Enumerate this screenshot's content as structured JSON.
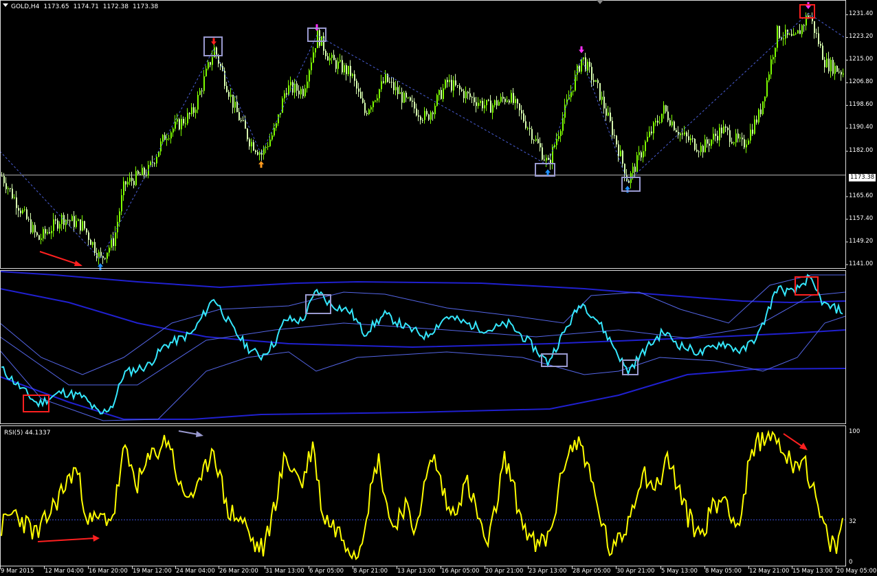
{
  "window": {
    "symbol": "GOLD,H4",
    "open": "1173.65",
    "high": "1174.71",
    "low": "1172.38",
    "close": "1173.38",
    "current_price": "1173.38"
  },
  "price_panel": {
    "y_labels": [
      "1231.40",
      "1223.20",
      "1215.00",
      "1206.80",
      "1198.60",
      "1190.40",
      "1182.00",
      "1173.38",
      "1165.60",
      "1157.40",
      "1149.20",
      "1141.00"
    ],
    "y_values": [
      1231.4,
      1223.2,
      1215.0,
      1206.8,
      1198.6,
      1190.4,
      1182.0,
      1173.38,
      1165.6,
      1157.4,
      1149.2,
      1141.0
    ],
    "ylim": [
      1138.5,
      1235.5
    ],
    "arrow_colors": {
      "up_blue": "#1e90ff",
      "up_orange": "#ff9a1e",
      "down_red": "#ff2020",
      "down_magenta": "#ff30ff"
    }
  },
  "indicator_panel": {
    "label": ""
  },
  "rsi_panel": {
    "title": "RSI(5) 44.1337",
    "levels": [
      "100",
      "32",
      "0"
    ],
    "level_values": [
      100,
      32,
      0
    ]
  },
  "x_axis": {
    "labels": [
      "9 Mar 2015",
      "12 Mar 04:00",
      "16 Mar 20:00",
      "19 Mar 12:00",
      "24 Mar 04:00",
      "26 Mar 20:00",
      "31 Mar 13:00",
      "6 Apr 05:00",
      "8 Apr 21:00",
      "13 Apr 13:00",
      "16 Apr 05:00",
      "20 Apr 21:00",
      "23 Apr 13:00",
      "28 Apr 05:00",
      "30 Apr 21:00",
      "5 May 13:00",
      "8 May 05:00",
      "12 May 21:00",
      "15 May 13:00",
      "20 May 05:00"
    ]
  },
  "colors": {
    "background": "#000000",
    "bull_candle": "#7fff00",
    "bear_candle": "#d8ffb0",
    "zigzag": "#4a5fd8",
    "rsi_line": "#ffff00",
    "indicator_line": "#35e8ff",
    "band_outer": "#2020d0",
    "band_inner": "#5566e8",
    "annotation_box": "#9a9ad0",
    "annotation_red": "#ff2020"
  },
  "chart_data": {
    "type": "line",
    "title": "GOLD,H4",
    "key_points": [
      {
        "x": "16 Mar 20:00",
        "y": 1143.0,
        "marker": "up-arrow"
      },
      {
        "x": "24 Mar 04:00",
        "y": 1219.0,
        "marker": "down-arrow"
      },
      {
        "x": "26 Mar 20:00",
        "y": 1180.0,
        "marker": "up-arrow"
      },
      {
        "x": "6 Apr 05:00",
        "y": 1224.0,
        "marker": "down-arrow"
      },
      {
        "x": "23 Apr 13:00",
        "y": 1177.0,
        "marker": "up-arrow"
      },
      {
        "x": "28 Apr 05:00",
        "y": 1216.0,
        "marker": "down-arrow"
      },
      {
        "x": "30 Apr 21:00",
        "y": 1171.0,
        "marker": "up-arrow"
      },
      {
        "x": "15 May 13:00",
        "y": 1232.0,
        "marker": "down-arrow"
      }
    ],
    "rsi_level": 32,
    "rsi_last": 44.1337,
    "ylim": [
      1141.0,
      1231.4
    ]
  }
}
